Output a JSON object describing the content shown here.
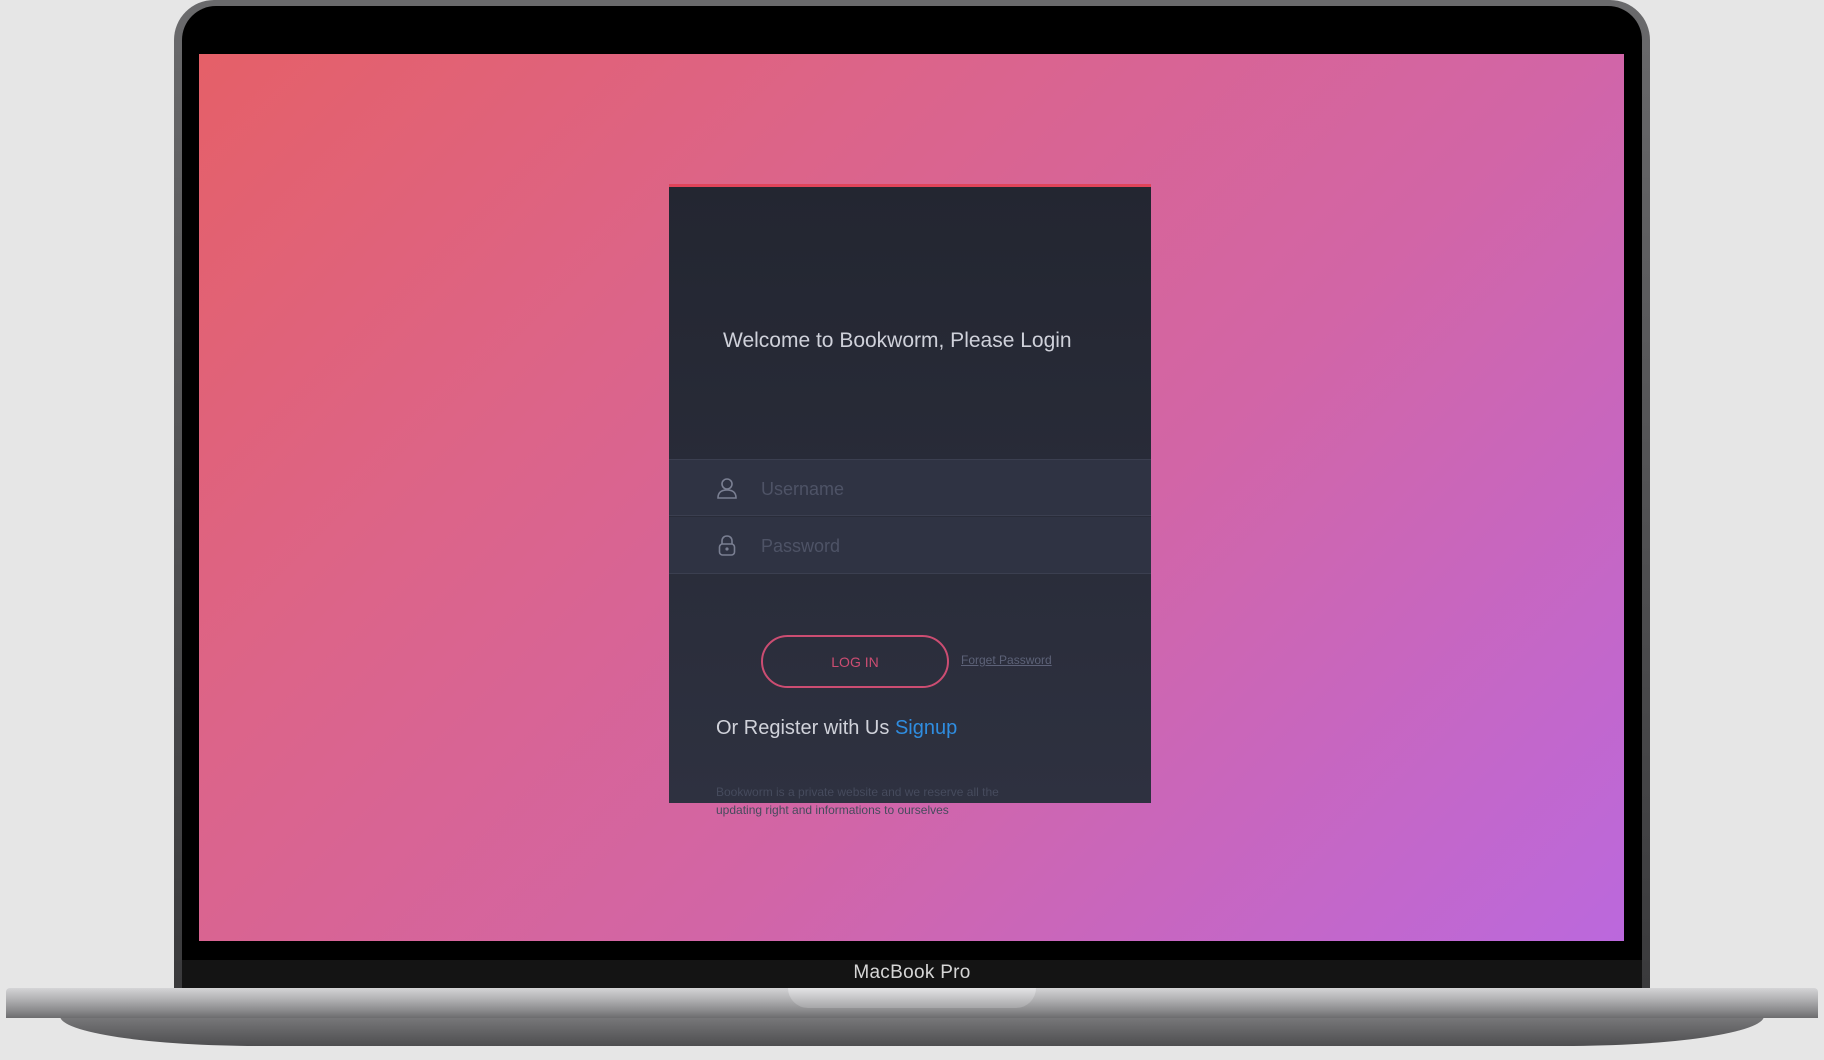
{
  "device": {
    "label": "MacBook Pro"
  },
  "login": {
    "title": "Welcome to Bookworm, Please Login",
    "username_placeholder": "Username",
    "password_placeholder": "Password",
    "login_label": "LOG IN",
    "forgot_label": "Forget Password",
    "register_text": "Or Register with Us",
    "signup_label": "Signup",
    "disclaimer": "Bookworm is a private website and we reserve all the updating right and informations to ourselves"
  },
  "icons": {
    "username": "user-icon",
    "password": "lock-icon"
  },
  "colors": {
    "accent": "#cc4d72",
    "link": "#2f8de0",
    "card_bg": "#2a2d3a",
    "gradient_start": "#e56068",
    "gradient_end": "#bb68dd"
  }
}
